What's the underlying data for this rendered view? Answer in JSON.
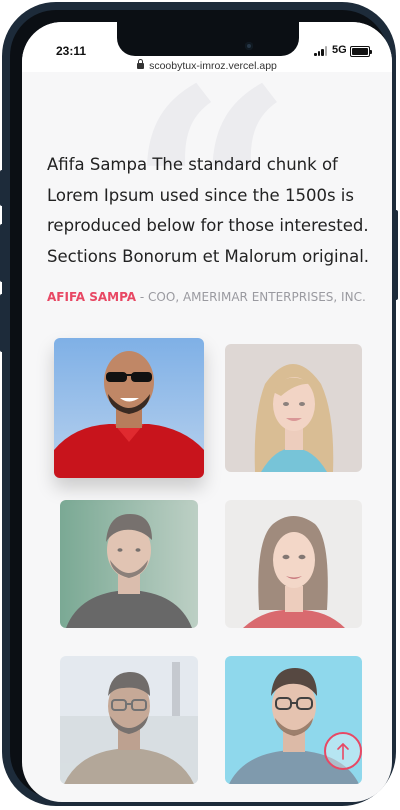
{
  "status_bar": {
    "time": "23:11",
    "network": "5G"
  },
  "browser": {
    "url": "scoobytux-imroz.vercel.app"
  },
  "testimonial": {
    "quote": "Afifa Sampa The standard chunk of Lorem Ipsum used since the 1500s is reproduced below for those interested. Sections Bonorum et Malorum original.",
    "author_name": "AFIFA SAMPA",
    "author_role": " - COO, AMERIMAR ENTERPRISES, INC."
  },
  "avatars": [
    {
      "id": "man-sunglasses-red-shirt",
      "active": true
    },
    {
      "id": "blonde-woman",
      "active": false
    },
    {
      "id": "man-black-shirt",
      "active": false
    },
    {
      "id": "woman-wet-hair",
      "active": false
    },
    {
      "id": "man-glasses-beach",
      "active": false
    },
    {
      "id": "man-glasses-blue-bg",
      "active": false
    }
  ],
  "colors": {
    "accent": "#e84864",
    "text": "#222222",
    "muted": "#9a9aa0"
  },
  "icons": {
    "scroll_top": "arrow-up-icon",
    "lock": "lock-icon"
  }
}
